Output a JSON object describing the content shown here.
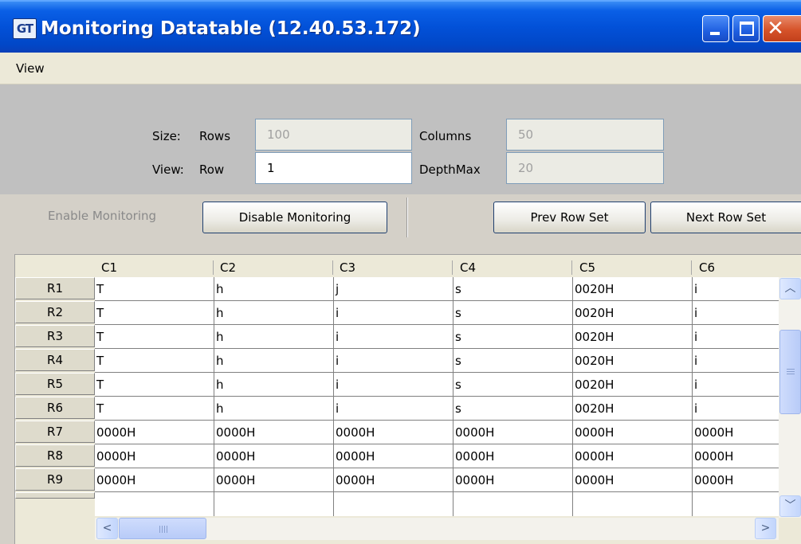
{
  "window": {
    "icon_text": "GT",
    "title": "Monitoring Datatable (12.40.53.172)"
  },
  "menubar": {
    "items": [
      "View"
    ]
  },
  "config": {
    "size_label": "Size:",
    "rows_label": "Rows",
    "rows_value": "100",
    "columns_label": "Columns",
    "columns_value": "50",
    "view_label": "View:",
    "row_label": "Row",
    "row_value": "1",
    "depthmax_label": "DepthMax",
    "depthmax_value": "20"
  },
  "buttons": {
    "enable_monitoring": "Enable Monitoring",
    "disable_monitoring": "Disable Monitoring",
    "prev_row_set": "Prev Row Set",
    "next_row_set": "Next Row Set"
  },
  "table": {
    "columns": [
      "C1",
      "C2",
      "C3",
      "C4",
      "C5",
      "C6"
    ],
    "rows": [
      {
        "header": "R1",
        "cells": [
          "T",
          "h",
          "j",
          "s",
          "0020H",
          "i"
        ]
      },
      {
        "header": "R2",
        "cells": [
          "T",
          "h",
          "i",
          "s",
          "0020H",
          "i"
        ]
      },
      {
        "header": "R3",
        "cells": [
          "T",
          "h",
          "i",
          "s",
          "0020H",
          "i"
        ]
      },
      {
        "header": "R4",
        "cells": [
          "T",
          "h",
          "i",
          "s",
          "0020H",
          "i"
        ]
      },
      {
        "header": "R5",
        "cells": [
          "T",
          "h",
          "i",
          "s",
          "0020H",
          "i"
        ]
      },
      {
        "header": "R6",
        "cells": [
          "T",
          "h",
          "i",
          "s",
          "0020H",
          "i"
        ]
      },
      {
        "header": "R7",
        "cells": [
          "0000H",
          "0000H",
          "0000H",
          "0000H",
          "0000H",
          "0000H"
        ]
      },
      {
        "header": "R8",
        "cells": [
          "0000H",
          "0000H",
          "0000H",
          "0000H",
          "0000H",
          "0000H"
        ]
      },
      {
        "header": "R9",
        "cells": [
          "0000H",
          "0000H",
          "0000H",
          "0000H",
          "0000H",
          "0000H"
        ]
      }
    ]
  },
  "icons": {
    "scroll_up": "scroll-up-arrow-icon",
    "scroll_down": "scroll-down-arrow-icon",
    "scroll_left": "scroll-left-arrow-icon",
    "scroll_right": "scroll-right-arrow-icon"
  },
  "colors": {
    "titlebar": "#0251d8",
    "config_panel": "#c0c0c0",
    "button_panel": "#d4d0c8",
    "close_button": "#d6532a"
  }
}
